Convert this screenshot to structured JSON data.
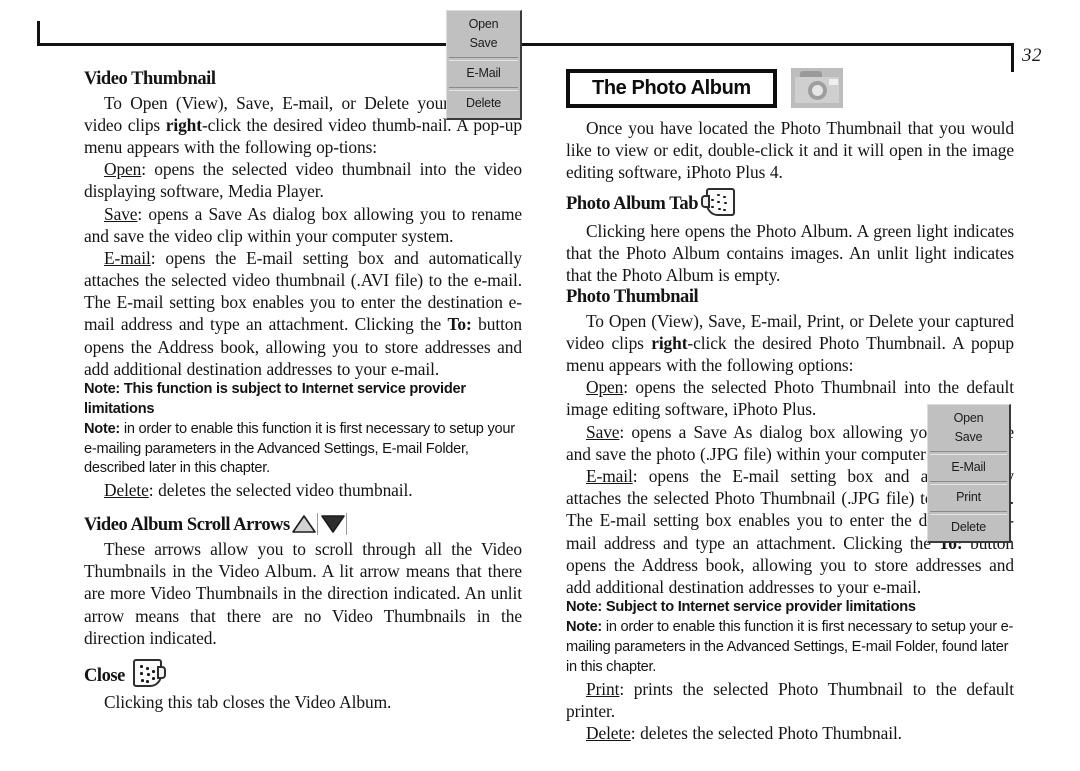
{
  "page": {
    "number": "32"
  },
  "left_column": {
    "section1": {
      "heading": "Video Thumbnail",
      "intro": "To Open (View), Save, E-mail, or Delete your captured video clips right-click the desired video thumbnail.  A pop-up menu appears with the following options:",
      "intro_parts": {
        "a": "To Open (View), Save, E-mail, or Delete your cap-tured video clips ",
        "bold": "right",
        "b": "-click the desired video thumb-nail.  A pop-up menu appears with the following op-tions:"
      },
      "open_term": "Open",
      "open_text": ": opens the selected video thumbnail into the video displaying software, Media Player.",
      "save_term": "Save",
      "save_text": ": opens a Save As dialog box allowing you to rename and save the video clip within your computer system.",
      "email_term": "E-mail",
      "email_text_a": ": opens the E-mail setting box and automatically attaches the selected video thumbnail (.AVI file) to the e-mail.  The E-mail setting box enables you to enter the destination e-mail address and type an attachment.  Clicking the ",
      "email_bold": "To:",
      "email_text_b": " button opens the Address book, allowing you to store addresses and add additional destination addresses to your e-mail.",
      "note1": "Note: This function is subject to Internet service provider limitations",
      "note2_label": "Note:",
      "note2_text": " in order to enable this function it is first necessary to setup your e-mailing parameters in the Advanced Settings, E-mail Folder, described later in this chapter.",
      "delete_term": "Delete",
      "delete_text": ": deletes the selected video thumbnail."
    },
    "section2": {
      "heading": "Video Album Scroll Arrows",
      "body": "These arrows allow you to scroll through all the Video Thumbnails  in the Video Album. A lit arrow means that there are more Video Thumbnails in the direction indicated.  An unlit arrow means that there are no Video Thumbnails in the direction indicated."
    },
    "section3": {
      "heading": "Close",
      "body": "Clicking this tab closes the Video Album."
    },
    "video_menu": {
      "items": [
        "Open",
        "Save",
        "E-Mail",
        "Delete"
      ]
    }
  },
  "right_column": {
    "title_box": "The Photo Album",
    "intro": "Once you have located the Photo Thumbnail that you would like to view or edit, double-click it and it will open in the image editing software, iPhoto Plus 4.",
    "section_tab": {
      "heading": "Photo Album Tab",
      "body": "Clicking here opens the Photo Album.  A green light indicates that the Photo Album contains images.  An unlit light indicates that the Photo Album is empty."
    },
    "section_thumb": {
      "heading": "Photo Thumbnail",
      "intro_a": "To Open (View), Save, E-mail, Print, or Delete your captured video clips ",
      "intro_bold": "right",
      "intro_b": "-click the desired Photo Thumbnail. A popup menu appears with the following options:",
      "open_term": "Open",
      "open_text": ": opens the selected Photo Thumbnail into the default image editing software, iPhoto Plus.",
      "save_term": "Save",
      "save_text": ": opens a Save As dialog box allowing you to rename and save the photo (.JPG file) within your computer system.",
      "email_term": "E-mail",
      "email_text_a": ": opens the E-mail setting box and automatically attaches the selected Photo Thumbnail (.JPG file) to the e-mail. The E-mail setting box enables you to enter the destination e-mail address and type an attachment.  Clicking the ",
      "email_bold": "To:",
      "email_text_b": " button opens the Address book, allowing you to store addresses and add additional destination addresses to your e-mail.",
      "note1": "Note: Subject to Internet service provider limitations",
      "note2_label": "Note:",
      "note2_text": " in order to enable this function it is first necessary to setup your e-mailing parameters in the Advanced Settings, E-mail Folder, found later in this chapter.",
      "print_term": "Print",
      "print_text": ": prints the selected Photo Thumbnail to the default printer.",
      "delete_term": "Delete",
      "delete_text": ": deletes the selected Photo Thumbnail."
    },
    "photo_menu": {
      "items": [
        "Open",
        "Save",
        "E-Mail",
        "Print",
        "Delete"
      ]
    }
  },
  "icons": {
    "camera": "camera-icon",
    "scroll_up": "triangle-up-icon",
    "scroll_down": "triangle-down-icon",
    "close_tab": "album-tab-icon",
    "photo_album_tab": "album-tab-icon"
  }
}
